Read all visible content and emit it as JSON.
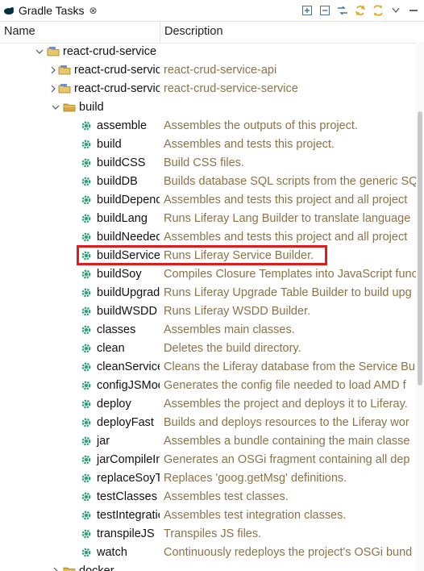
{
  "tab": {
    "title": "Gradle Tasks",
    "close": "⊗"
  },
  "columns": {
    "name": "Name",
    "description": "Description"
  },
  "colors": {
    "description_text": "#8a7348",
    "highlight": "#e01b1b",
    "folder": "#d9a93b",
    "gear": "#2e9e74"
  },
  "rows": [
    {
      "name": "react-crud-service",
      "desc": "",
      "indent": 1,
      "twisty": "⌵",
      "icon": "project",
      "expanded": true
    },
    {
      "name": "react-crud-service-api",
      "desc": "react-crud-service-api",
      "indent": 2,
      "twisty": ">",
      "icon": "project"
    },
    {
      "name": "react-crud-service-service",
      "desc": "react-crud-service-service",
      "indent": 2,
      "twisty": ">",
      "icon": "project"
    },
    {
      "name": "build",
      "desc": "",
      "indent": 2,
      "twisty": "⌵",
      "icon": "folder",
      "expanded": true
    },
    {
      "name": "assemble",
      "desc": "Assembles the outputs of this project.",
      "indent": 3,
      "icon": "gear"
    },
    {
      "name": "build",
      "desc": "Assembles and tests this project.",
      "indent": 3,
      "icon": "gear"
    },
    {
      "name": "buildCSS",
      "desc": "Build CSS files.",
      "indent": 3,
      "icon": "gear"
    },
    {
      "name": "buildDB",
      "desc": "Builds database SQL scripts from the generic SQL",
      "indent": 3,
      "icon": "gear"
    },
    {
      "name": "buildDependents",
      "desc": "Assembles and tests this project and all project",
      "indent": 3,
      "icon": "gear"
    },
    {
      "name": "buildLang",
      "desc": "Runs Liferay Lang Builder to translate language",
      "indent": 3,
      "icon": "gear"
    },
    {
      "name": "buildNeeded",
      "desc": "Assembles and tests this project and all project",
      "indent": 3,
      "icon": "gear"
    },
    {
      "name": "buildService",
      "desc": "Runs Liferay Service Builder.",
      "indent": 3,
      "icon": "gear",
      "highlighted": true
    },
    {
      "name": "buildSoy",
      "desc": "Compiles Closure Templates into JavaScript func",
      "indent": 3,
      "icon": "gear"
    },
    {
      "name": "buildUpgradeTable",
      "desc": "Runs Liferay Upgrade Table Builder to build upg",
      "indent": 3,
      "icon": "gear"
    },
    {
      "name": "buildWSDD",
      "desc": "Runs Liferay WSDD Builder.",
      "indent": 3,
      "icon": "gear"
    },
    {
      "name": "classes",
      "desc": "Assembles main classes.",
      "indent": 3,
      "icon": "gear"
    },
    {
      "name": "clean",
      "desc": "Deletes the build directory.",
      "indent": 3,
      "icon": "gear"
    },
    {
      "name": "cleanServiceBuilder",
      "desc": "Cleans the Liferay database from the Service Bu",
      "indent": 3,
      "icon": "gear"
    },
    {
      "name": "configJSModules",
      "desc": "Generates the config file needed to load AMD f",
      "indent": 3,
      "icon": "gear"
    },
    {
      "name": "deploy",
      "desc": "Assembles the project and deploys it to Liferay.",
      "indent": 3,
      "icon": "gear"
    },
    {
      "name": "deployFast",
      "desc": "Builds and deploys resources to the Liferay wor",
      "indent": 3,
      "icon": "gear"
    },
    {
      "name": "jar",
      "desc": "Assembles a bundle containing the main classe",
      "indent": 3,
      "icon": "gear"
    },
    {
      "name": "jarCompileInclude",
      "desc": "Generates an OSGi fragment containing all dep",
      "indent": 3,
      "icon": "gear"
    },
    {
      "name": "replaceSoyTranslation",
      "desc": "Replaces 'goog.getMsg' definitions.",
      "indent": 3,
      "icon": "gear"
    },
    {
      "name": "testClasses",
      "desc": "Assembles test classes.",
      "indent": 3,
      "icon": "gear"
    },
    {
      "name": "testIntegration",
      "desc": "Assembles test integration classes.",
      "indent": 3,
      "icon": "gear"
    },
    {
      "name": "transpileJS",
      "desc": "Transpiles JS files.",
      "indent": 3,
      "icon": "gear"
    },
    {
      "name": "watch",
      "desc": "Continuously redeploys the project's OSGi bund",
      "indent": 3,
      "icon": "gear"
    },
    {
      "name": "docker",
      "desc": "",
      "indent": 2,
      "twisty": ">",
      "icon": "folder"
    }
  ]
}
